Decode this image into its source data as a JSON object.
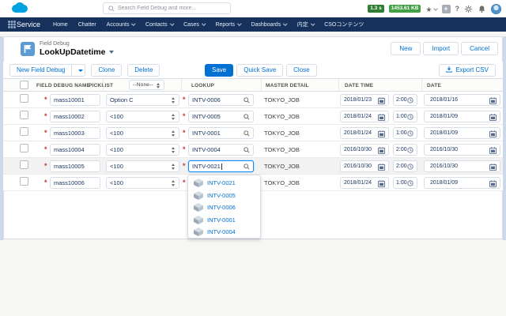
{
  "topbar": {
    "search_placeholder": "Search Field Debug and more...",
    "badges": [
      {
        "label": "1.3 s"
      },
      {
        "label": "1453.61 KB"
      }
    ],
    "help_label": "?"
  },
  "nav": {
    "app_name": "Service",
    "tabs": [
      {
        "label": "Home"
      },
      {
        "label": "Chatter"
      },
      {
        "label": "Accounts"
      },
      {
        "label": "Contacts"
      },
      {
        "label": "Cases"
      },
      {
        "label": "Reports"
      },
      {
        "label": "Dashboards"
      },
      {
        "label": "内定"
      },
      {
        "label": "CSOコンテンツ"
      }
    ]
  },
  "page_header": {
    "object_label": "Field Debug",
    "title": "LookUpDatetime",
    "actions": {
      "new": "New",
      "import": "Import",
      "cancel": "Cancel"
    }
  },
  "toolbar": {
    "new_field_debug": "New Field Debug",
    "clone": "Clone",
    "delete": "Delete",
    "save": "Save",
    "quick_save": "Quick Save",
    "close": "Close",
    "export_csv": "Export CSV"
  },
  "table": {
    "required_marker": "*",
    "columns": [
      "FIELD DEBUG NAME",
      "PICKLIST",
      "LOOKUP",
      "MASTER DETAIL",
      "DATE TIME",
      "DATE"
    ],
    "picklist_filter": "--None--",
    "rows": [
      {
        "name": "mass10001",
        "picklist": "Option C",
        "lookup": "INTV-0006",
        "master_detail": "TOKYO_JOB",
        "datetime_date": "2018/01/23",
        "datetime_time": "2:00",
        "date": "2018/01/16"
      },
      {
        "name": "mass10002",
        "picklist": "<100",
        "lookup": "INTV-0005",
        "master_detail": "TOKYO_JOB",
        "datetime_date": "2018/01/24",
        "datetime_time": "1:00",
        "date": "2018/01/09"
      },
      {
        "name": "mass10003",
        "picklist": "<100",
        "lookup": "INTV-0001",
        "master_detail": "TOKYO_JOB",
        "datetime_date": "2018/01/24",
        "datetime_time": "1:00",
        "date": "2018/01/09"
      },
      {
        "name": "mass10004",
        "picklist": "<100",
        "lookup": "INTV-0004",
        "master_detail": "TOKYO_JOB",
        "datetime_date": "2016/10/30",
        "datetime_time": "2:00",
        "date": "2016/10/30"
      },
      {
        "name": "mass10005",
        "picklist": "<100",
        "lookup": "INTV-0021",
        "master_detail": "TOKYO_JOB",
        "datetime_date": "2016/10/30",
        "datetime_time": "2:00",
        "date": "2016/10/30"
      },
      {
        "name": "mass10006",
        "picklist": "<100",
        "lookup": "",
        "master_detail": "TOKYO_JOB",
        "datetime_date": "2018/01/24",
        "datetime_time": "1:00",
        "date": "2018/01/09"
      }
    ]
  },
  "lookup_dropdown": {
    "items": [
      {
        "label": "INTV-0021"
      },
      {
        "label": "INTV-0005"
      },
      {
        "label": "INTV-0006"
      },
      {
        "label": "INTV-0001"
      },
      {
        "label": "INTV-0004"
      }
    ]
  },
  "colors": {
    "accent": "#0070d2",
    "nav_bg": "#16325c",
    "required": "#c23934",
    "focus_border": "#1589ee",
    "badge_time": "#2e7d32",
    "badge_size": "#43a047",
    "logo": "#00a1e0"
  }
}
